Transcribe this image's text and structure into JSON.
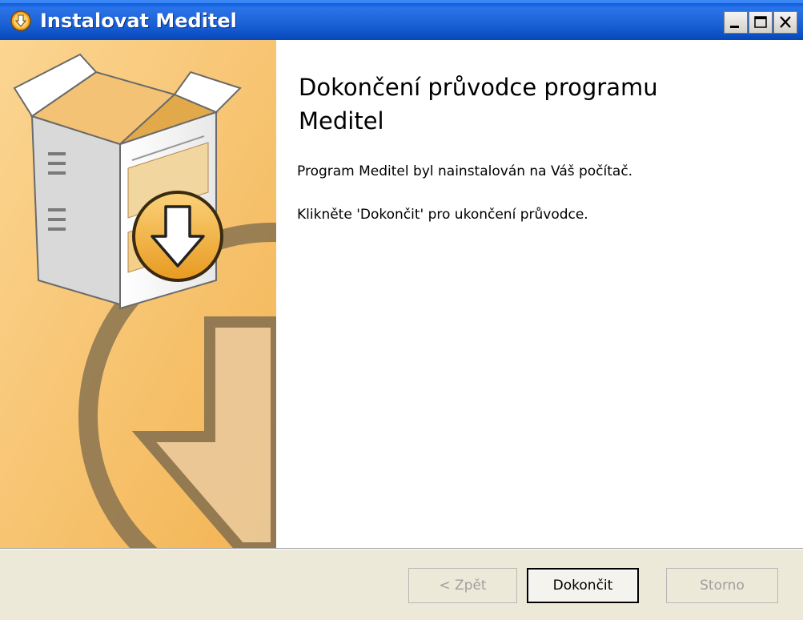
{
  "window": {
    "title": "Instalovat Meditel"
  },
  "content": {
    "heading": "Dokončení průvodce programu Meditel",
    "installed_text": "Program Meditel byl nainstalován na Váš počítač.",
    "instruction_text": "Klikněte 'Dokončit' pro ukončení průvodce."
  },
  "buttons": {
    "back_label": "< Zpět",
    "finish_label": "Dokončit",
    "cancel_label": "Storno"
  },
  "icons": {
    "app": "installer-icon",
    "side_graphic": "package-box-with-download-arrow"
  },
  "colors": {
    "titlebar": "#1f65d8",
    "side_panel": "#f7c46e",
    "bottom_bar": "#ece9d8"
  }
}
